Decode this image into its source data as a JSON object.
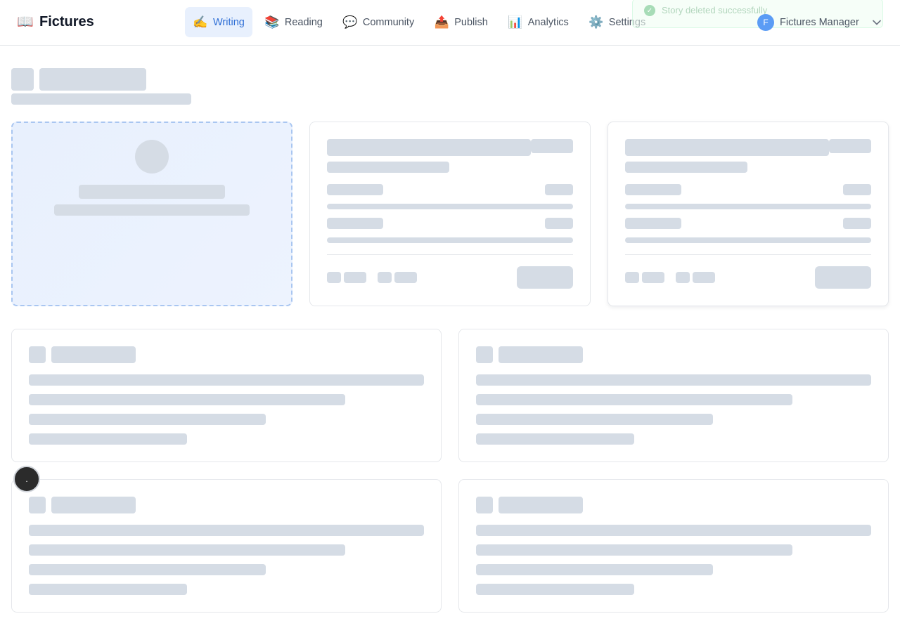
{
  "app": {
    "title": "Fictures",
    "logo_icon": "open-book-icon"
  },
  "nav": {
    "items": [
      {
        "label": "Writing",
        "icon": "writing-hand-icon",
        "glyph": "✍️",
        "active": true
      },
      {
        "label": "Reading",
        "icon": "books-icon",
        "glyph": "📚",
        "active": false
      },
      {
        "label": "Community",
        "icon": "speech-bubble-icon",
        "glyph": "💬",
        "active": false
      },
      {
        "label": "Publish",
        "icon": "outbox-tray-icon",
        "glyph": "📤",
        "active": false
      },
      {
        "label": "Analytics",
        "icon": "bar-chart-icon",
        "glyph": "📊",
        "active": false
      },
      {
        "label": "Settings",
        "icon": "gear-icon",
        "glyph": "⚙️",
        "active": false
      }
    ]
  },
  "toast": {
    "message": "Story deleted successfully"
  },
  "user": {
    "initial": "F",
    "name": "Fictures Manager"
  },
  "fab": {
    "label": "."
  },
  "colors": {
    "accent": "#2f6fd6",
    "skeleton": "#d5dce5",
    "avatar": "#5b9cf5"
  }
}
